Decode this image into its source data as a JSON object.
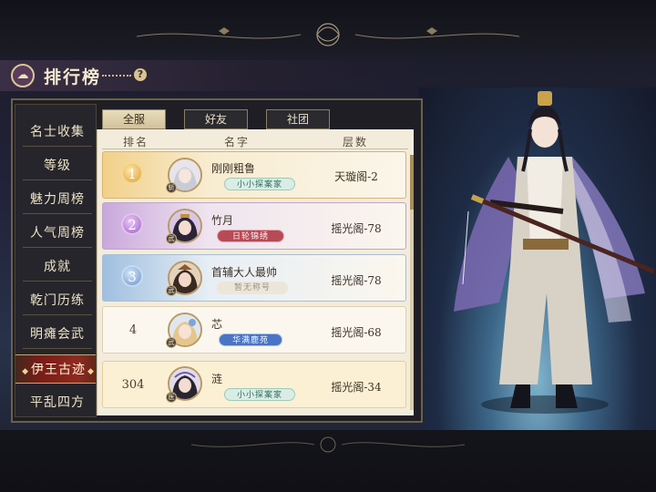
{
  "header": {
    "title": "排行榜",
    "emblem_icon": "cloud-emblem-icon",
    "help_glyph": "?"
  },
  "sidebar": {
    "items": [
      {
        "label": "名士收集"
      },
      {
        "label": "等级"
      },
      {
        "label": "魅力周榜"
      },
      {
        "label": "人气周榜"
      },
      {
        "label": "成就"
      },
      {
        "label": "乾门历练"
      },
      {
        "label": "明瘫会武"
      },
      {
        "label": "伊王古迹",
        "active": true
      },
      {
        "label": "平乱四方"
      }
    ]
  },
  "tabs": [
    {
      "label": "全服",
      "active": true
    },
    {
      "label": "好友"
    },
    {
      "label": "社团"
    }
  ],
  "columns": {
    "rank": "排名",
    "name": "名字",
    "floor": "层数"
  },
  "rows": [
    {
      "rank": "1",
      "name": "刚刚粗鲁",
      "title": "小小探案家",
      "floor": "天璇阁-2",
      "badge": "斩"
    },
    {
      "rank": "2",
      "name": "竹月",
      "title": "日轮锦绣",
      "floor": "摇光阁-78",
      "badge": "武"
    },
    {
      "rank": "3",
      "name": "首辅大人最帅",
      "title": "暂无称号",
      "floor": "摇光阁-78",
      "badge": "武"
    },
    {
      "rank": "4",
      "name": "芯",
      "title": "华满鹿苑",
      "floor": "摇光阁-68",
      "badge": "武"
    },
    {
      "rank": "304",
      "name": "涟",
      "title": "小小探案家",
      "floor": "摇光阁-34",
      "badge": "医"
    }
  ],
  "colors": {
    "active_sidebar": "#8e2a20",
    "list_bg": "#f3ecdc",
    "gold": "#d9a03c",
    "purple": "#9b63c4",
    "blue": "#6a93c8"
  }
}
